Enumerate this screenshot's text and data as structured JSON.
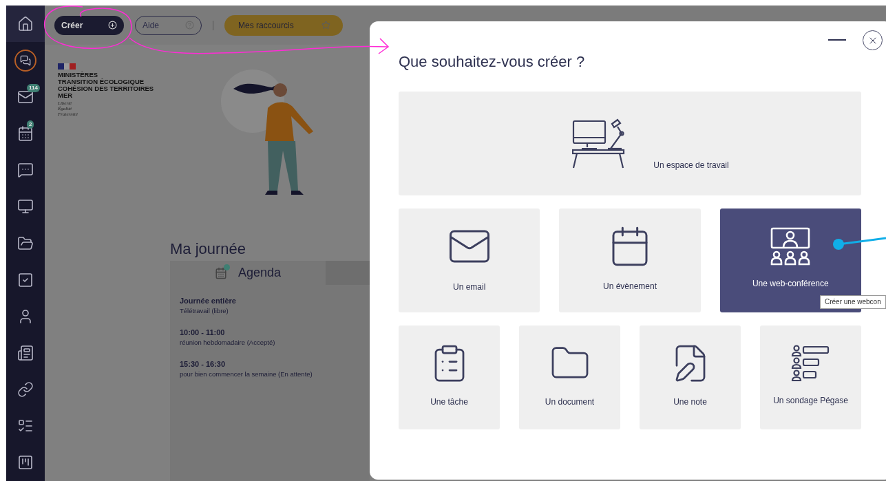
{
  "sidebar": {
    "items": [
      {
        "kind": "home",
        "selected": true
      },
      {
        "kind": "chat-history",
        "selected": false
      },
      {
        "kind": "mail",
        "selected": false,
        "badge": "114"
      },
      {
        "kind": "calendar",
        "selected": false,
        "badge": "2"
      },
      {
        "kind": "chat",
        "selected": false
      },
      {
        "kind": "workspace",
        "selected": false
      },
      {
        "kind": "folder",
        "selected": false
      },
      {
        "kind": "task",
        "selected": false
      },
      {
        "kind": "user",
        "selected": false
      },
      {
        "kind": "news",
        "selected": false
      },
      {
        "kind": "link",
        "selected": false
      },
      {
        "kind": "survey",
        "selected": false
      },
      {
        "kind": "board",
        "selected": false
      }
    ]
  },
  "toolbar": {
    "create_button": "Créer",
    "help_button": "Aide",
    "shortcuts_button": "Mes raccourcis"
  },
  "logo": {
    "lines": [
      "MINISTÈRES",
      "TRANSITION ÉCOLOGIQUE",
      "COHÉSION DES TERRITOIRES",
      "MER"
    ],
    "motto": [
      "Liberté",
      "Égalité",
      "Fraternité"
    ]
  },
  "my_day": {
    "title": "Ma journée",
    "agenda_tab": "Agenda",
    "events": [
      {
        "time": "Journée entière",
        "label": "Télétravail (libre)"
      },
      {
        "time": "10:00 - 11:00",
        "label": "réunion hebdomadaire (Accepté)"
      },
      {
        "time": "15:30 - 16:30",
        "label": "pour bien commencer la semaine (En attente)"
      }
    ]
  },
  "dialog": {
    "title": "Que souhaitez-vous créer ?",
    "rows": [
      {
        "options": [
          {
            "kind": "workspace",
            "label": "Un espace de travail",
            "selected": false
          }
        ]
      },
      {
        "options": [
          {
            "kind": "email",
            "label": "Un email",
            "selected": false
          },
          {
            "kind": "event",
            "label": "Un évènement",
            "selected": false
          },
          {
            "kind": "webconference",
            "label": "Une web-conférence",
            "selected": true
          }
        ]
      },
      {
        "options": [
          {
            "kind": "task",
            "label": "Une tâche",
            "selected": false
          },
          {
            "kind": "document",
            "label": "Un document",
            "selected": false
          },
          {
            "kind": "note",
            "label": "Une note",
            "selected": false
          },
          {
            "kind": "survey",
            "label": "Un sondage Pégase",
            "selected": false
          }
        ]
      }
    ],
    "tooltip": "Créer une webcon"
  }
}
